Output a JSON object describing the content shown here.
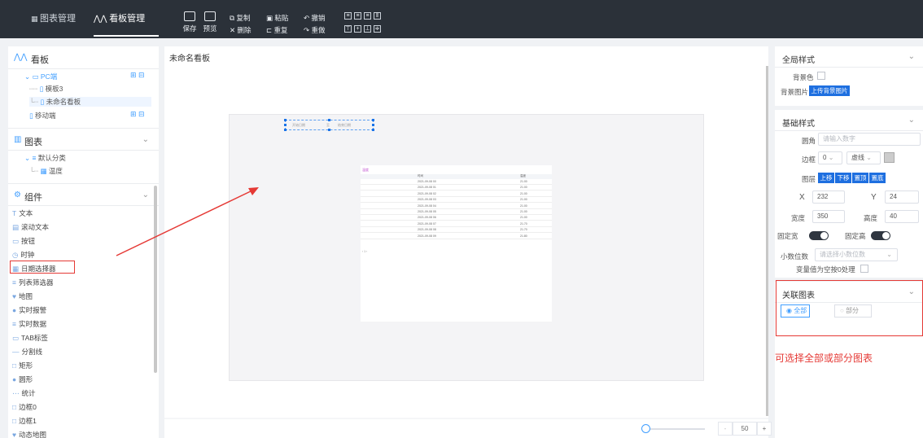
{
  "topnav": {
    "chart_mgmt": "图表管理",
    "board_mgmt": "看板管理"
  },
  "toolbar": {
    "save": "保存",
    "preview": "预览",
    "copy": "复制",
    "delete": "删除",
    "paste": "粘贴",
    "repeat": "重复",
    "undo": "撤销",
    "redo": "重做"
  },
  "left": {
    "board_title": "看板",
    "pc": "PC端",
    "template3": "模板3",
    "unnamed": "未命名看板",
    "mobile": "移动端",
    "chart_title": "图表",
    "default_category": "默认分类",
    "temperature": "温度",
    "components_title": "组件",
    "components": [
      "文本",
      "滚动文本",
      "按钮",
      "时钟",
      "日期选择器",
      "列表筛选器",
      "地图",
      "实时报警",
      "实时数据",
      "TAB标签",
      "分割线",
      "矩形",
      "圆形",
      "统计",
      "边框0",
      "边框1",
      "动态地图"
    ]
  },
  "center": {
    "board_name": "未命名看板",
    "widget_start": "开始日期",
    "widget_sep": "至",
    "widget_end": "结束日期",
    "zoom_value": "50",
    "zoom_minus": "-",
    "zoom_plus": "+"
  },
  "mini_table": {
    "header": [
      "时间",
      "温度"
    ],
    "rows": [
      [
        "2021-09-08 00",
        "21.00"
      ],
      [
        "2021-09-08 01",
        "21.00"
      ],
      [
        "2021-09-08 02",
        "21.00"
      ],
      [
        "2021-09-08 03",
        "21.00"
      ],
      [
        "2021-09-08 04",
        "21.00"
      ],
      [
        "2021-09-08 05",
        "21.00"
      ],
      [
        "2021-09-08 06",
        "21.00"
      ],
      [
        "2021-09-08 07",
        "21.70"
      ],
      [
        "2021-09-08 08",
        "21.70"
      ],
      [
        "2021-09-08 09",
        "21.80"
      ]
    ]
  },
  "right": {
    "global_style": "全局样式",
    "bg_color": "背景色",
    "bg_image": "背景图片",
    "upload_bg": "上传背景图片",
    "base_style": "基础样式",
    "radius": "圆角",
    "radius_ph": "请输入数字",
    "border": "边框",
    "border_val": "0",
    "border_style": "虚线",
    "layer": "图层",
    "layer_btns": [
      "上移",
      "下移",
      "置顶",
      "置底"
    ],
    "x_label": "X",
    "x_val": "232",
    "y_label": "Y",
    "y_val": "24",
    "width_label": "宽度",
    "width_val": "350",
    "height_label": "高度",
    "height_val": "40",
    "fixed_width": "固定宽",
    "fixed_height": "固定高",
    "decimals": "小数位数",
    "decimals_ph": "请选择小数位数",
    "null_zero": "变量值为空按0处理",
    "linked_charts": "关联图表",
    "all": "全部",
    "partial": "部分"
  },
  "annotation": "可选择全部或部分图表",
  "colors": {
    "accent": "#409eff",
    "topbar": "#2b3139",
    "highlight": "#e53935"
  }
}
